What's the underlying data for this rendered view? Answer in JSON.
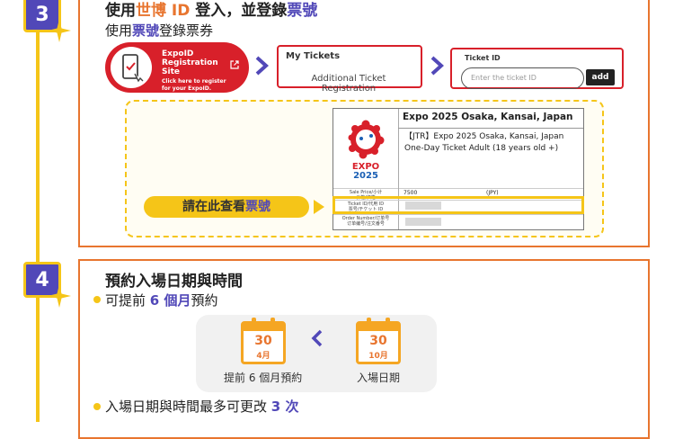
{
  "step3": {
    "number": "3",
    "title_parts": [
      "使用",
      "世博 ID",
      " 登入，並登錄",
      "票號"
    ],
    "subtitle_parts": [
      "使用",
      "票號",
      "登錄票券"
    ],
    "expoid": {
      "title_line1": "ExpoID",
      "title_line2": "Registration Site",
      "hint_line1": "Click here to register",
      "hint_line2": "for your ExpoID."
    },
    "my_tickets": {
      "label": "My Tickets",
      "link": "Additional Ticket Registration"
    },
    "ticket_id": {
      "label": "Ticket ID",
      "placeholder": "Enter the ticket ID",
      "add_label": "add"
    },
    "sample_ticket": {
      "logo_text": "EXPO",
      "logo_year": "2025",
      "event_title": "Expo 2025 Osaka, Kansai, Japan",
      "description": "【JTR】Expo 2025 Osaka, Kansai, Japan One-Day Ticket Adult (18 years old +)",
      "price_label_1": "Sale Price/小计",
      "price_label_2": "价格/価格",
      "price_value": "7500",
      "price_unit": "(JPY)",
      "ticket_id_label_1": "Ticket ID/代用 ID",
      "ticket_id_label_2": "票号/チケット ID",
      "order_label_1": "Order Number/订单号",
      "order_label_2": "订单编号/注文番号"
    },
    "check_hint_parts": [
      "請在此查看",
      "票號"
    ]
  },
  "step4": {
    "number": "4",
    "title": "預約入場日期與時間",
    "bullet1_parts": [
      "可提前 ",
      "6 個月",
      "預約"
    ],
    "calendar_left": {
      "day": "30",
      "month": "4月",
      "caption": "提前 6 個月預約"
    },
    "calendar_right": {
      "day": "30",
      "month": "10月",
      "caption": "入場日期"
    },
    "bullet2_parts": [
      "入場日期與時間最多可更改 ",
      "3 次"
    ]
  },
  "colors": {
    "accent_purple": "#5148b8",
    "accent_orange": "#e8752f",
    "accent_yellow": "#f5c518",
    "accent_red": "#d8202a"
  }
}
